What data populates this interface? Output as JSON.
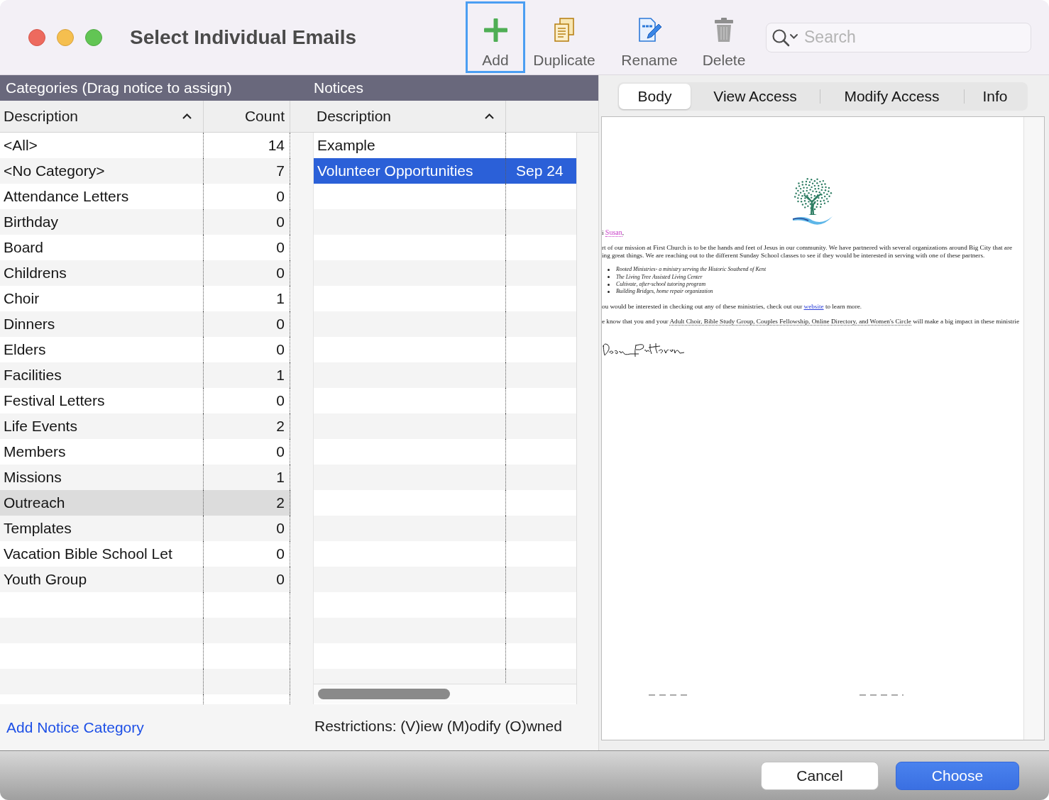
{
  "window": {
    "title": "Select Individual Emails"
  },
  "toolbar": [
    {
      "kind": "add",
      "label": "Add",
      "focused": true
    },
    {
      "kind": "duplicate",
      "label": "Duplicate",
      "focused": false
    },
    {
      "kind": "rename",
      "label": "Rename",
      "focused": false
    },
    {
      "kind": "delete",
      "label": "Delete",
      "focused": false
    }
  ],
  "search": {
    "placeholder": "Search"
  },
  "categories": {
    "title": "Categories (Drag notice to assign)",
    "columns": [
      {
        "label": "Description",
        "sorted": true
      },
      {
        "label": "Count",
        "sorted": false
      }
    ],
    "rows": [
      {
        "description": "<All>",
        "count": "14",
        "selected": false
      },
      {
        "description": "<No Category>",
        "count": "7",
        "selected": false
      },
      {
        "description": "Attendance Letters",
        "count": "0",
        "selected": false
      },
      {
        "description": "Birthday",
        "count": "0",
        "selected": false
      },
      {
        "description": "Board",
        "count": "0",
        "selected": false
      },
      {
        "description": "Childrens",
        "count": "0",
        "selected": false
      },
      {
        "description": "Choir",
        "count": "1",
        "selected": false
      },
      {
        "description": "Dinners",
        "count": "0",
        "selected": false
      },
      {
        "description": "Elders",
        "count": "0",
        "selected": false
      },
      {
        "description": "Facilities",
        "count": "1",
        "selected": false
      },
      {
        "description": "Festival Letters",
        "count": "0",
        "selected": false
      },
      {
        "description": "Life Events",
        "count": "2",
        "selected": false
      },
      {
        "description": "Members",
        "count": "0",
        "selected": false
      },
      {
        "description": "Missions",
        "count": "1",
        "selected": false
      },
      {
        "description": "Outreach",
        "count": "2",
        "selected": true
      },
      {
        "description": "Templates",
        "count": "0",
        "selected": false
      },
      {
        "description": "Vacation Bible School Let",
        "count": "0",
        "selected": false
      },
      {
        "description": "Youth Group",
        "count": "0",
        "selected": false
      }
    ]
  },
  "notices": {
    "title": "Notices",
    "columns": [
      {
        "label": "Description",
        "sorted": true
      }
    ],
    "rows": [
      {
        "description": "Example",
        "selected": false
      },
      {
        "description": "Volunteer Opportunities",
        "column_2": "Sep 24",
        "selected": true
      }
    ]
  },
  "tabs": [
    {
      "label": "Body",
      "selected": true
    },
    {
      "label": "View Access",
      "selected": false
    },
    {
      "label": "Modify Access",
      "selected": false
    },
    {
      "label": "Info",
      "selected": false
    }
  ],
  "preview": {
    "blocks": [
      {
        "kind": "paragraph",
        "lines": [
          [
            {
              "kind": "text",
              "text": "i "
            },
            {
              "kind": "name",
              "text": "Susan"
            },
            {
              "kind": "text",
              "text": ","
            }
          ]
        ]
      },
      {
        "kind": "paragraph",
        "lines": [
          [
            {
              "kind": "text",
              "text": "rt of our mission at First Church is to be the hands and feet of Jesus in our community. We have partnered with several organizations around Big City that are"
            }
          ],
          [
            {
              "kind": "text",
              "text": "ing great things. We are reaching out to the different Sunday School classes to see if they would be interested in serving with one of these partners."
            }
          ]
        ]
      },
      {
        "kind": "bullets",
        "items": [
          "Rooted Ministries- a ministry serving the Historic Southend of Kent",
          "The Living Tree Assisted Living Center",
          "Cultivate, after-school tutoring program",
          "Building Bridges, home repair organization"
        ]
      },
      {
        "kind": "paragraph",
        "lines": [
          [
            {
              "kind": "text",
              "text": "ou would be interested in checking out any of these ministries, check out our "
            },
            {
              "kind": "link",
              "text": "website"
            },
            {
              "kind": "text",
              "text": " to learn more."
            }
          ]
        ]
      },
      {
        "kind": "paragraph",
        "lines": [
          [
            {
              "kind": "text",
              "text": "e know that you and your "
            },
            {
              "kind": "field",
              "text": "Adult Choir, Bible Study Group, Couples Fellowship, Online Directory, and Women's Circle"
            },
            {
              "kind": "text",
              "text": " will make a big impact in these ministrie"
            }
          ]
        ]
      }
    ]
  },
  "footer": {
    "link": "Add Notice Category",
    "restrictions": "Restrictions: (V)iew (M)odify (O)wned"
  },
  "buttons": [
    {
      "label": "Cancel",
      "primary": false
    },
    {
      "label": "Choose",
      "primary": true
    }
  ]
}
